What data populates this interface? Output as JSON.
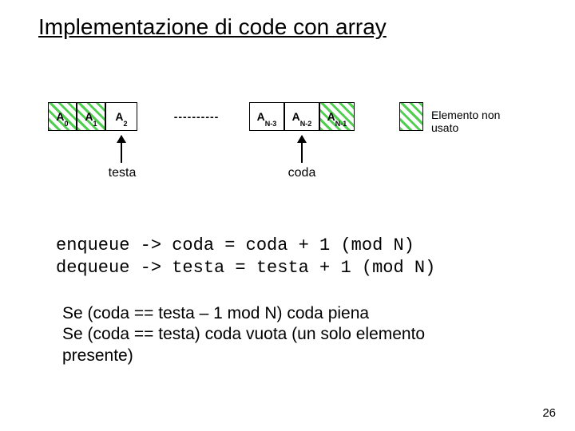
{
  "title": "Implementazione di code con array",
  "cells": {
    "a0": {
      "A": "A",
      "sub": "0"
    },
    "a1": {
      "A": "A",
      "sub": "1"
    },
    "a2": {
      "A": "A",
      "sub": "2"
    },
    "dots": "----------",
    "an3": {
      "A": "A",
      "sub": "N-3"
    },
    "an2": {
      "A": "A",
      "sub": "N-2"
    },
    "an1": {
      "A": "A",
      "sub": "N-1"
    }
  },
  "legend": "Elemento non usato",
  "pointers": {
    "testa": "testa",
    "coda": "coda"
  },
  "code": {
    "line1": "enqueue -> coda = coda + 1 (mod N)",
    "line2": "dequeue -> testa = testa + 1 (mod N)"
  },
  "note": {
    "line1": "Se (coda == testa – 1 mod N) coda piena",
    "line2": "Se (coda == testa) coda vuota (un solo elemento",
    "line3": "presente)"
  },
  "pagenum": "26"
}
